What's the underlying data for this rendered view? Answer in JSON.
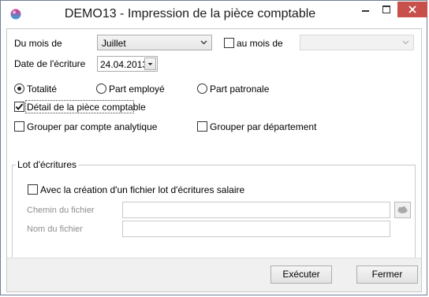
{
  "window": {
    "title": "DEMO13 - Impression de la pièce comptable",
    "brand_colors": {
      "close_button": "#c7504a",
      "icon_top": "#e6338a",
      "icon_bottom": "#2aa8e0"
    }
  },
  "period": {
    "from_label": "Du mois de",
    "from_value": "Juillet",
    "to_checkbox_label": "au mois de",
    "to_checked": false,
    "to_value": ""
  },
  "entry_date": {
    "label": "Date de l'écriture",
    "value": "24.04.2013"
  },
  "share": {
    "options": [
      {
        "label": "Totalité",
        "selected": true
      },
      {
        "label": "Part employé",
        "selected": false
      },
      {
        "label": "Part patronale",
        "selected": false
      }
    ]
  },
  "options": {
    "detail": {
      "label": "Détail de la pièce comptable",
      "checked": true
    },
    "group_analytic": {
      "label": "Grouper par compte analytique",
      "checked": false
    },
    "group_department": {
      "label": "Grouper par département",
      "checked": false
    }
  },
  "batch": {
    "group_title": "Lot d'écritures",
    "create_label": "Avec la création d'un fichier lot d'écritures salaire",
    "create_checked": false,
    "path_label": "Chemin du fichier",
    "path_value": "",
    "name_label": "Nom du fichier",
    "name_value": ""
  },
  "buttons": {
    "execute": "Exécuter",
    "close": "Fermer"
  }
}
